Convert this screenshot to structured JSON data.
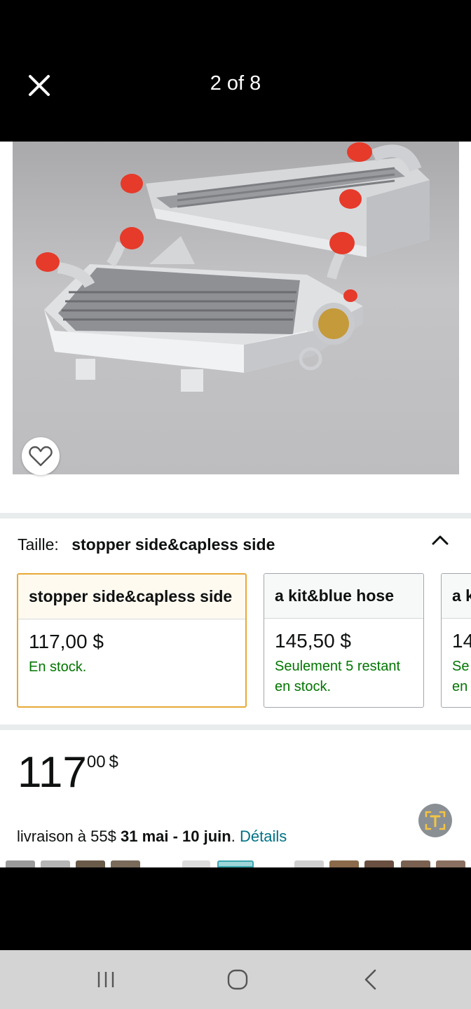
{
  "viewer": {
    "counter": "2 of 8",
    "close_icon": "close-icon"
  },
  "product": {
    "image_icon": "radiator-photo",
    "wishlist_icon": "heart-icon"
  },
  "size": {
    "label": "Taille:",
    "selected_value": "stopper side&capless side",
    "collapse_icon": "chevron-up-icon"
  },
  "options": [
    {
      "name": "stopper side&capless side",
      "price": "117,00 $",
      "stock": "En stock.",
      "selected": true
    },
    {
      "name": "a kit&blue hose",
      "price": "145,50 $",
      "stock": "Seulement 5 restant en stock.",
      "selected": false
    },
    {
      "name": "a k",
      "price": "14",
      "stock": "Se en",
      "selected": false
    }
  ],
  "price": {
    "whole": "117",
    "fraction": "00",
    "currency": "$"
  },
  "delivery": {
    "prefix": "livraison à 55$",
    "dates": "31 mai - 10 juin",
    "separator": ".",
    "link": "Détails"
  },
  "translate_icon": "translate-icon",
  "navigation": {
    "recents_icon": "recents-icon",
    "home_icon": "home-icon",
    "back_icon": "back-icon"
  },
  "colors": {
    "accent_selected": "#e7a936",
    "in_stock": "#007600",
    "link": "#007185"
  }
}
